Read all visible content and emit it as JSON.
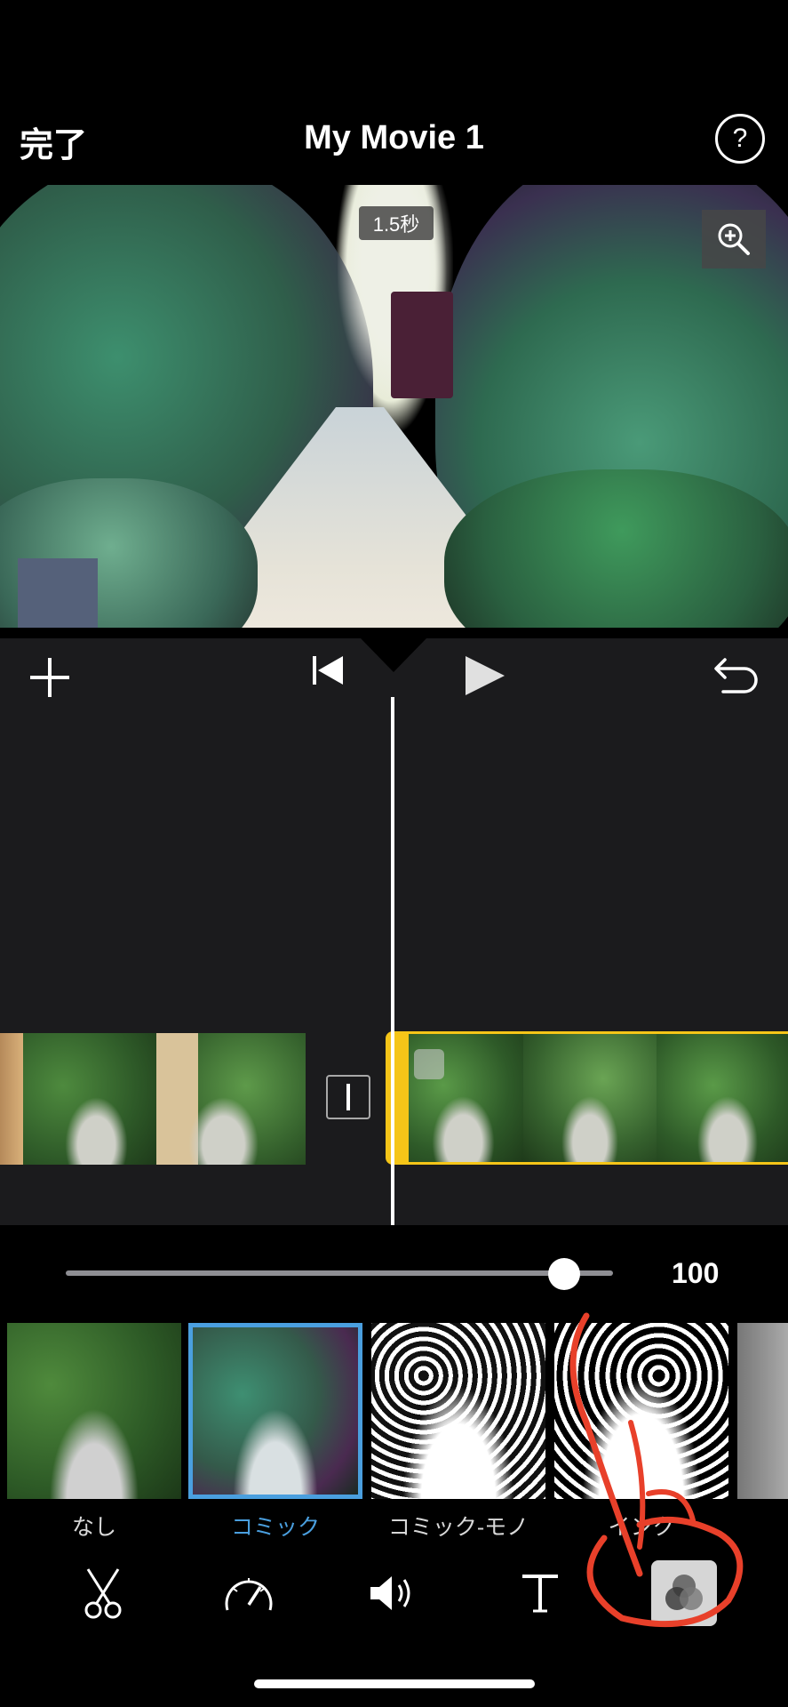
{
  "header": {
    "done_label": "完了",
    "title": "My Movie 1",
    "help_label": "?"
  },
  "viewer": {
    "duration": "1.5秒"
  },
  "slider": {
    "value": "100",
    "fraction": 0.91
  },
  "filters": [
    {
      "label": "なし",
      "selected": false
    },
    {
      "label": "コミック",
      "selected": true
    },
    {
      "label": "コミック-モノ",
      "selected": false
    },
    {
      "label": "インク",
      "selected": false
    },
    {
      "label": "",
      "selected": false
    }
  ],
  "toolbar": [
    {
      "name": "scissors-icon"
    },
    {
      "name": "speed-gauge-icon"
    },
    {
      "name": "volume-icon"
    },
    {
      "name": "title-text-icon"
    },
    {
      "name": "filters-icon"
    }
  ],
  "colors": {
    "accent": "#4a9fdf",
    "clip_selected": "#f5c518",
    "annotation": "#e8402a"
  }
}
